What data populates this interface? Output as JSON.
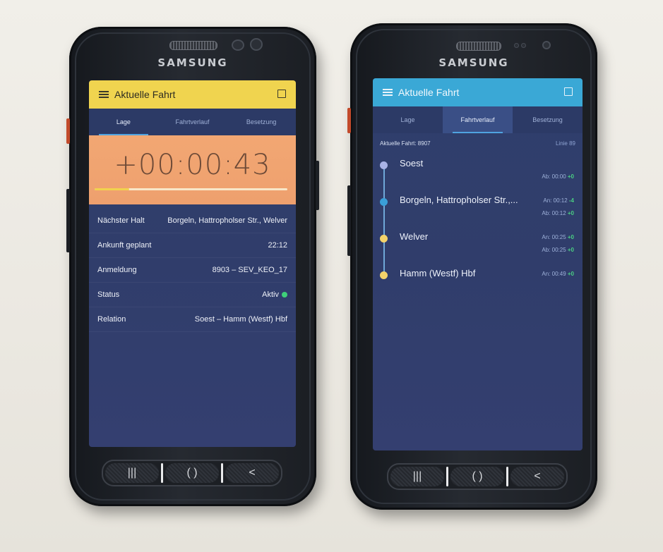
{
  "left_phone": {
    "brand": "SAMSUNG",
    "appbar": {
      "title": "Aktuelle Fahrt",
      "color": "#f0d44f"
    },
    "tabs": [
      "Lage",
      "Fahrtverlauf",
      "Besetzung"
    ],
    "active_tab": "Lage",
    "timer": {
      "value": "+00:00:43",
      "progress": 0.18
    },
    "info": [
      {
        "label": "Nächster Halt",
        "value": "Borgeln, Hattropholser Str., Welver"
      },
      {
        "label": "Ankunft geplant",
        "value": "22:12"
      },
      {
        "label": "Anmeldung",
        "value": "8903 – SEV_KEO_17"
      },
      {
        "label": "Status",
        "value": "Aktiv"
      },
      {
        "label": "Relation",
        "value": "Soest – Hamm (Westf) Hbf"
      }
    ],
    "status_color": "#3fd07a"
  },
  "right_phone": {
    "brand": "SAMSUNG",
    "appbar": {
      "title": "Aktuelle Fahrt",
      "color": "#3aa8d6"
    },
    "tabs": [
      "Lage",
      "Fahrtverlauf",
      "Besetzung"
    ],
    "active_tab": "Fahrtverlauf",
    "trip": {
      "label": "Aktuelle Fahrt: 8907",
      "line": "Linie 89"
    },
    "stops": [
      {
        "name": "Soest",
        "dot_color": "#a9b3e6",
        "t1": "",
        "d1": "",
        "t2": "Ab: 00:00",
        "d2": "+0"
      },
      {
        "name": "Borgeln, Hattropholser Str.,...",
        "dot_color": "#3a9fd8",
        "t1": "An: 00:12",
        "d1": "-4",
        "t2": "Ab: 00:12",
        "d2": "+0"
      },
      {
        "name": "Welver",
        "dot_color": "#f4d36a",
        "t1": "An: 00:25",
        "d1": "+0",
        "t2": "Ab: 00:25",
        "d2": "+0"
      },
      {
        "name": "Hamm (Westf) Hbf",
        "dot_color": "#f4d36a",
        "t1": "An: 00:49",
        "d1": "+0",
        "t2": "",
        "d2": ""
      }
    ]
  },
  "nav_buttons": {
    "recents": "|||",
    "home": "( )",
    "back": "<"
  }
}
